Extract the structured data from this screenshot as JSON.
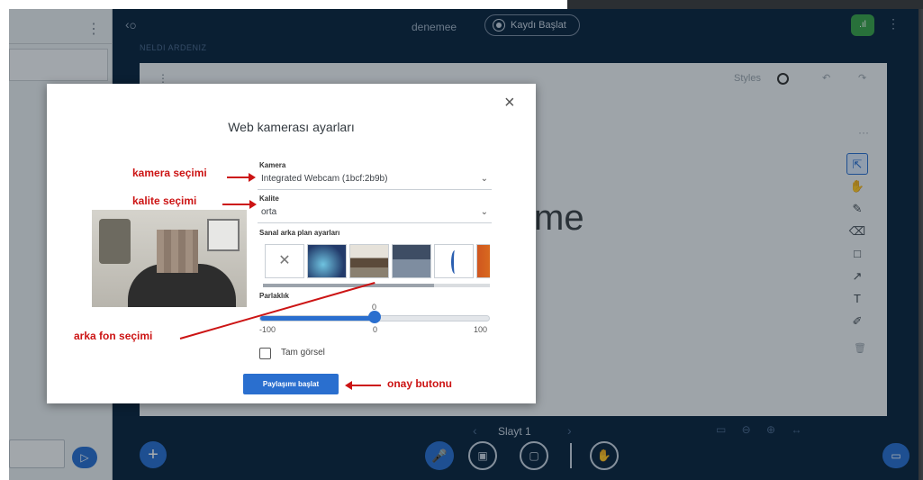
{
  "app": {
    "meeting_title": "denemee",
    "record_label": "Kaydı Başlat",
    "presenter_name": "NELDI ARDENIZ",
    "styles_label": "Styles",
    "slide_label": "Slayt 1",
    "big_text": "me"
  },
  "icons": {
    "user": "user-icon",
    "dots": "more-icon",
    "record": "record-icon",
    "signal": "signal-icon",
    "undo": "undo-icon",
    "redo": "redo-icon",
    "select": "select-arrow-icon",
    "hand": "hand-icon",
    "pencil": "pencil-icon",
    "eraser": "eraser-icon",
    "rect": "rectangle-icon",
    "arrow": "arrow-icon",
    "text": "text-icon",
    "note": "note-icon",
    "trash": "trash-icon",
    "mic": "microphone-icon",
    "camera": "camera-icon",
    "screen": "screen-share-icon",
    "send": "send-icon",
    "plus": "plus-icon",
    "present": "presentation-icon"
  },
  "modal": {
    "title": "Web kamerası ayarları",
    "camera_label": "Kamera",
    "camera_value": "Integrated Webcam (1bcf:2b9b)",
    "quality_label": "Kalite",
    "quality_value": "orta",
    "background_label": "Sanal arka plan ayarları",
    "brightness_label": "Parlaklık",
    "brightness_value": "0",
    "brightness_min": "-100",
    "brightness_mid": "0",
    "brightness_max": "100",
    "brightness_level": 0.5,
    "full_view_label": "Tam görsel",
    "start_button": "Paylaşımı başlat",
    "close": "×"
  },
  "annotations": {
    "camera": "kamera seçimi",
    "quality": "kalite seçimi",
    "background": "arka fon seçimi",
    "confirm": "onay butonu"
  },
  "colors": {
    "accent": "#2a6fcf",
    "annotation": "#cc1414",
    "app_bg": "#0c2540"
  }
}
